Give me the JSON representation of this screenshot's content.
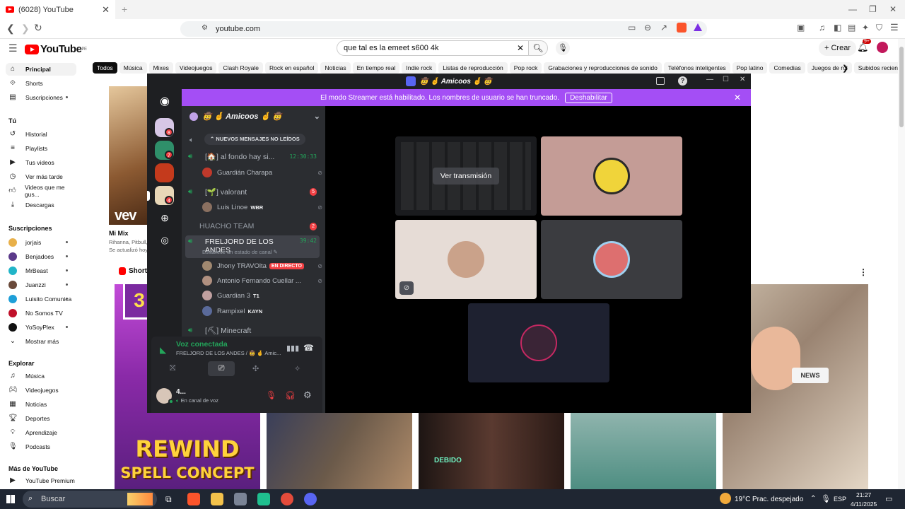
{
  "browser": {
    "tab_title": "(6028) YouTube",
    "address": "youtube.com"
  },
  "youtube": {
    "logo_text": "YouTube",
    "logo_region": "PE",
    "search_value": "que tal es la emeet s600 4k",
    "create_label": "Crear",
    "notif_count": "9+",
    "chips": [
      "Todos",
      "Música",
      "Mixes",
      "Videojuegos",
      "Clash Royale",
      "Rock en español",
      "Noticias",
      "En tiempo real",
      "Indie rock",
      "Listas de reproducción",
      "Pop rock",
      "Grabaciones y reproducciones de sonido",
      "Teléfonos inteligentes",
      "Pop latino",
      "Comedias",
      "Juegos de rol",
      "Subidos recientemente"
    ],
    "sidebar": {
      "main": [
        "Principal",
        "Shorts",
        "Suscripciones"
      ],
      "you_header": "Tú",
      "you": [
        "Historial",
        "Playlists",
        "Tus videos",
        "Ver más tarde",
        "Videos que me gus...",
        "Descargas"
      ],
      "subs_header": "Suscripciones",
      "subs": [
        "jorjais",
        "Benjadoes",
        "MrBeast",
        "Juanzzi",
        "Luisito Comunica",
        "No Somos TV",
        "YoSoyPlex"
      ],
      "show_more": "Mostrar más",
      "explore_header": "Explorar",
      "explore": [
        "Música",
        "Videojuegos",
        "Noticias",
        "Deportes",
        "Aprendizaje",
        "Podcasts"
      ],
      "more_header": "Más de YouTube",
      "more": [
        "YouTube Premium"
      ]
    },
    "mix": {
      "title": "Mi Mix",
      "sub1": "Rihanna, Pitbull, C",
      "sub2": "Se actualizó hoy",
      "thumb_text": "vev"
    },
    "shorts_label": "Shorts",
    "short_texts": {
      "rewind": "REWIND",
      "spell": "SPELL CONCEPT",
      "num": "3",
      "debido": "DEBIDO",
      "news": "NEWS"
    }
  },
  "discord": {
    "title": "🤠 🤞 Amicoos 🤞 🤠",
    "banner_text": "El modo Streamer está habilitado. Los nombres de usuario se han truncado.",
    "banner_button": "Deshabilitar",
    "server_name": "🤠 🤞 Amicoos 🤞 🤠",
    "new_messages": "NUEVOS MENSAJES NO LEÍDOS",
    "server_badges": [
      "8",
      "7",
      "",
      "4"
    ],
    "channels": [
      {
        "name": "[🏠] al fondo hay si...",
        "meta": "12:30:33"
      },
      {
        "name": "[🌱] valorant",
        "meta": "5"
      },
      {
        "name": "HUACHO TEAM",
        "meta": "2"
      },
      {
        "name": "FRELJORD DE LOS ANDES",
        "meta": "39:42",
        "status": "Establece un estado de canal ✎"
      },
      {
        "name": "[⛏] Minecraft",
        "meta": ""
      }
    ],
    "users": [
      {
        "name": "Guardián Charapa",
        "tag": ""
      },
      {
        "name": "Luis Linoe",
        "tag": "WBR"
      },
      {
        "name": "Jhony TRAVOlta",
        "tag": "EN DIRECTO"
      },
      {
        "name": "Antonio Fernando Cuellar ...",
        "tag": ""
      },
      {
        "name": "Guardian 3",
        "tag": "T1"
      },
      {
        "name": "Rampixel",
        "tag": "KAYN"
      }
    ],
    "watch_stream": "Ver transmisión",
    "voice_connected": "Voz conectada",
    "voice_channel": "FRELJORD DE LOS ANDES / 🤠 🤞 Amic...",
    "self_name": "4...",
    "self_status": "En canal de voz"
  },
  "taskbar": {
    "search": "Buscar",
    "weather": "19°C",
    "weather_desc": "Prac. despejado",
    "lang": "ESP",
    "time": "21:27",
    "date": "4/11/2025"
  },
  "colors": {
    "yt_red": "#ff0000",
    "discord_purple": "#a44ef5",
    "discord_green": "#23a55a",
    "discord_red": "#f23f43"
  }
}
